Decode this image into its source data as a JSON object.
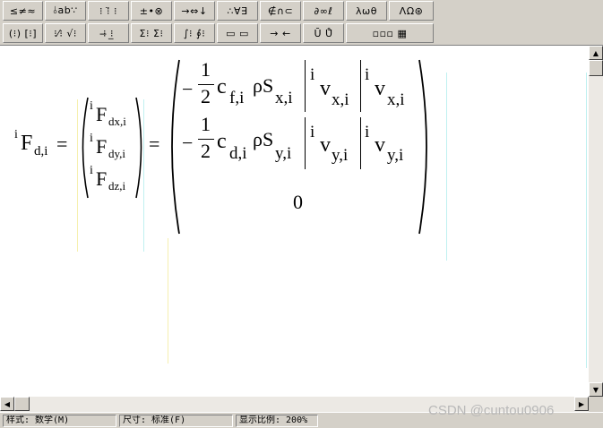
{
  "toolbar": {
    "row1": [
      "≤≠≈",
      "⫰ab∵",
      "⁝ ⁝̈ ⁝",
      "±•⊗",
      "→⇔↓",
      "∴∀∃",
      "∉∩⊂",
      "∂∞ℓ",
      "λωθ",
      "ΛΩ⊛"
    ],
    "row2": [
      "(⁝) [⁝]",
      "⁝⁄⁝ √⁝",
      "⁝̶ ⁝̲",
      "Σ⁝ Σ⁝",
      "∫⁝ ∮⁝",
      "▭ ▭",
      "→ ←",
      "Ū Ů̇",
      "▫▫▫ ▦"
    ]
  },
  "equation": {
    "lhs_pre": "i",
    "lhs_base": "F",
    "lhs_sub": "d,i",
    "eq1": "=",
    "vec": [
      {
        "pre": "i",
        "base": "F",
        "sub": "dx,i"
      },
      {
        "pre": "i",
        "base": "F",
        "sub": "dy,i"
      },
      {
        "pre": "i",
        "base": "F",
        "sub": "dz,i"
      }
    ],
    "eq2": "=",
    "row1": {
      "minus": "−",
      "num": "1",
      "den": "2",
      "c": "c",
      "c_sub": "f,i",
      "rho": "ρS",
      "s_sub": "x,i",
      "abs_pre": "i",
      "abs_v": "v",
      "abs_sub": "x,i",
      "v2_pre": "i",
      "v2": "v",
      "v2_sub": "x,i"
    },
    "row2": {
      "minus": "−",
      "num": "1",
      "den": "2",
      "c": "c",
      "c_sub": "d,i",
      "rho": "ρS",
      "s_sub": "y,i",
      "abs_pre": "i",
      "abs_v": "v",
      "abs_sub": "y,i",
      "v2_pre": "i",
      "v2": "v",
      "v2_sub": "y,i"
    },
    "row3": "0"
  },
  "status": {
    "style": "样式: 数学(M)",
    "size": "尺寸: 标准(F)",
    "zoom": "显示比例: 200%"
  },
  "watermark": "CSDN @cuntou0906"
}
